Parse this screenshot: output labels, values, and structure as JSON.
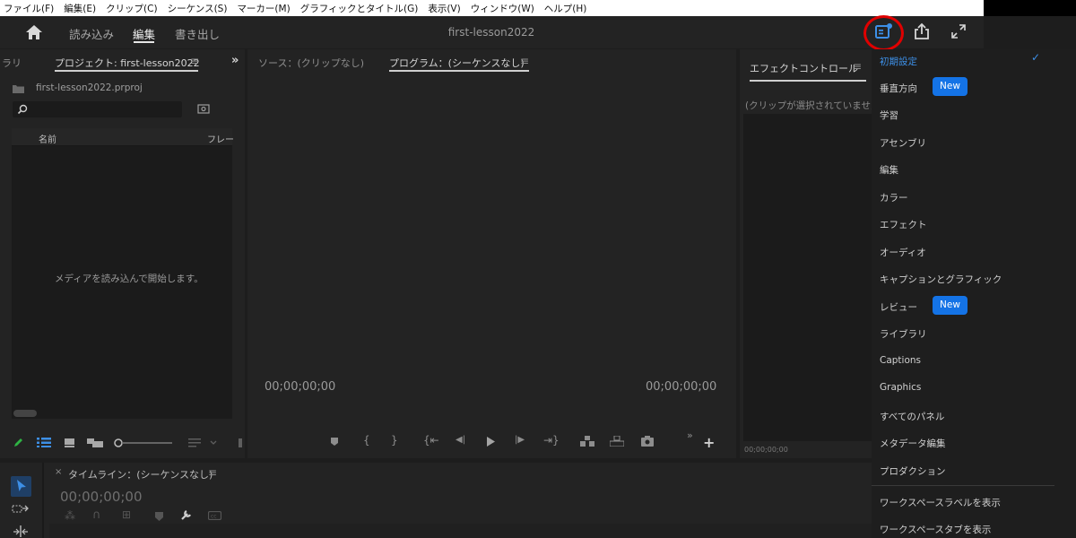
{
  "menu": [
    "ファイル(F)",
    "編集(E)",
    "クリップ(C)",
    "シーケンス(S)",
    "マーカー(M)",
    "グラフィックとタイトル(G)",
    "表示(V)",
    "ウィンドウ(W)",
    "ヘルプ(H)"
  ],
  "header": {
    "tabs": [
      "読み込み",
      "編集",
      "書き出し"
    ],
    "active_tab": "編集",
    "title": "first-lesson2022"
  },
  "project": {
    "prev_tab": "ラリ",
    "tab": "プロジェクト: first-lesson2022",
    "more": "»",
    "file": "first-lesson2022.prproj",
    "col_name": "名前",
    "col_frame": "フレー",
    "empty": "メディアを読み込んで開始します。"
  },
  "monitor": {
    "source_tab": "ソース：(クリップなし)",
    "program_tab": "プログラム：(シーケンスなし)",
    "tc_left": "00;00;00;00",
    "tc_right": "00;00;00;00"
  },
  "effects": {
    "tab": "エフェクトコントロール",
    "empty": "(クリップが選択されていません",
    "tc": "00;00;00;00"
  },
  "timeline": {
    "tab": "タイムライン：(シーケンスなし)",
    "tc": "00;00;00;00"
  },
  "workspaces": {
    "items": [
      "初期設定",
      "垂直方向",
      "学習",
      "アセンブリ",
      "編集",
      "カラー",
      "エフェクト",
      "オーディオ",
      "キャプションとグラフィック",
      "レビュー",
      "ライブラリ",
      "Captions",
      "Graphics",
      "すべてのパネル",
      "メタデータ編集",
      "プロダクション"
    ],
    "selected": "初期設定",
    "check": "✓",
    "new_badge": "New",
    "show_label": "ワークスペースラベルを表示",
    "show_tabs": "ワークスペースタブを表示"
  },
  "colors": {
    "accent": "#1473e6",
    "highlight_ring": "#e00000"
  }
}
